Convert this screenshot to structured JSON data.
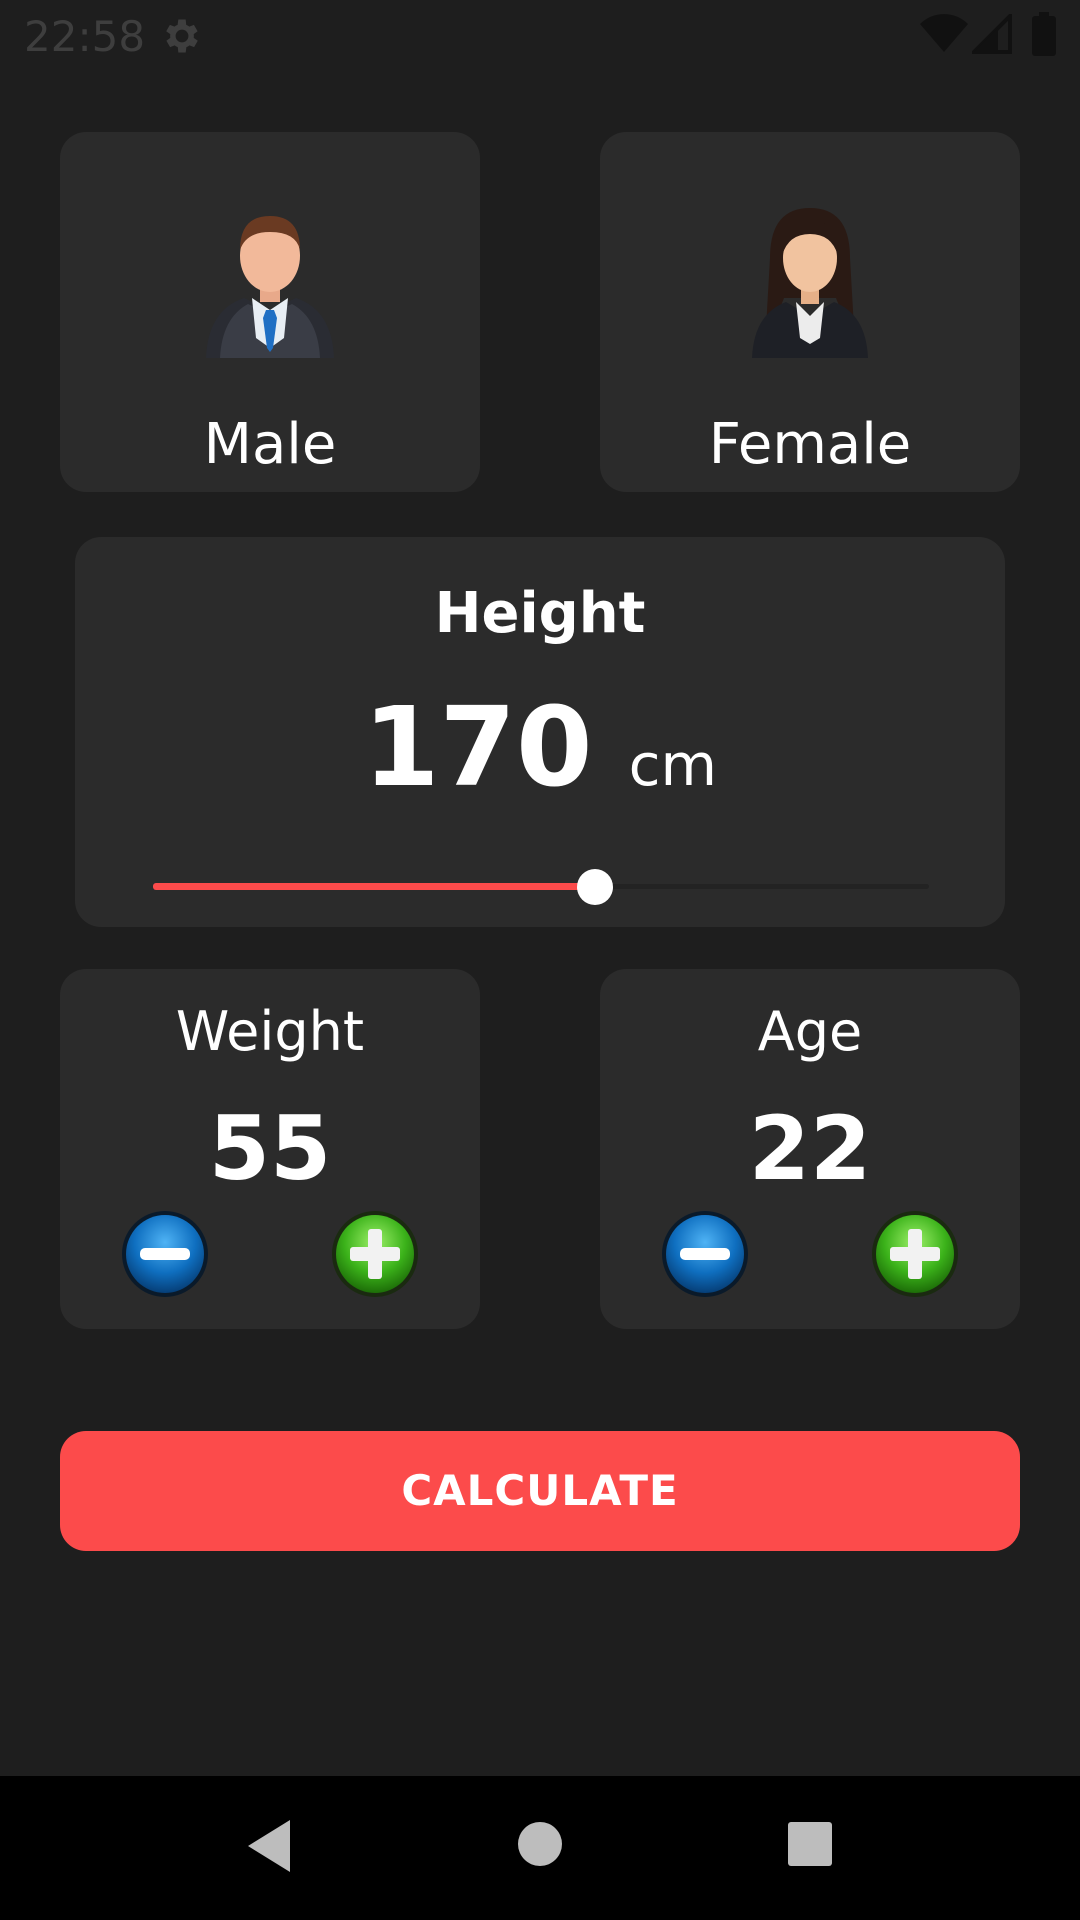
{
  "status_bar": {
    "time": "22:58",
    "icons": [
      "gear-icon",
      "wifi-icon",
      "signal-icon",
      "battery-icon"
    ]
  },
  "gender": {
    "male_label": "Male",
    "female_label": "Female",
    "icons": [
      "male-avatar-icon",
      "female-avatar-icon"
    ]
  },
  "height": {
    "title": "Height",
    "value": "170",
    "unit": "cm",
    "slider_fraction": 0.57
  },
  "weight": {
    "title": "Weight",
    "value": "55"
  },
  "age": {
    "title": "Age",
    "value": "22"
  },
  "actions": {
    "calculate_label": "CALCULATE"
  },
  "nav": {
    "icons": [
      "back-icon",
      "home-icon",
      "recents-icon"
    ]
  },
  "colors": {
    "background": "#1e1e1e",
    "card": "#2b2b2b",
    "accent": "#fc4b4b",
    "nav_bar": "#000000"
  }
}
